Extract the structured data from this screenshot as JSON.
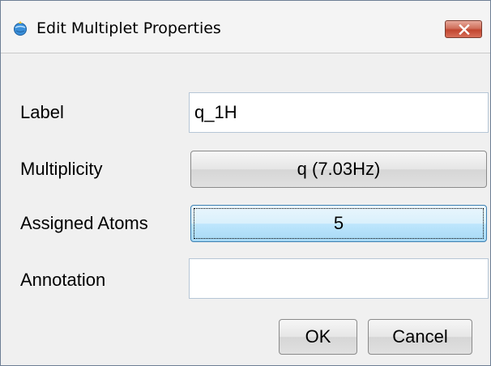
{
  "window": {
    "title": "Edit Multiplet Properties",
    "app_icon": "globe-app-icon",
    "close_icon": "close-icon",
    "close_button_color": "#c1452f"
  },
  "form": {
    "label": {
      "caption": "Label",
      "value": "q_1H"
    },
    "multiplicity": {
      "caption": "Multiplicity",
      "button_label": "q (7.03Hz)"
    },
    "assigned_atoms": {
      "caption": "Assigned Atoms",
      "button_label": "5"
    },
    "annotation": {
      "caption": "Annotation",
      "value": ""
    }
  },
  "buttons": {
    "ok": "OK",
    "cancel": "Cancel"
  },
  "colors": {
    "focused_button": "#bee6fd",
    "dialog_background": "#f0f0f0"
  }
}
